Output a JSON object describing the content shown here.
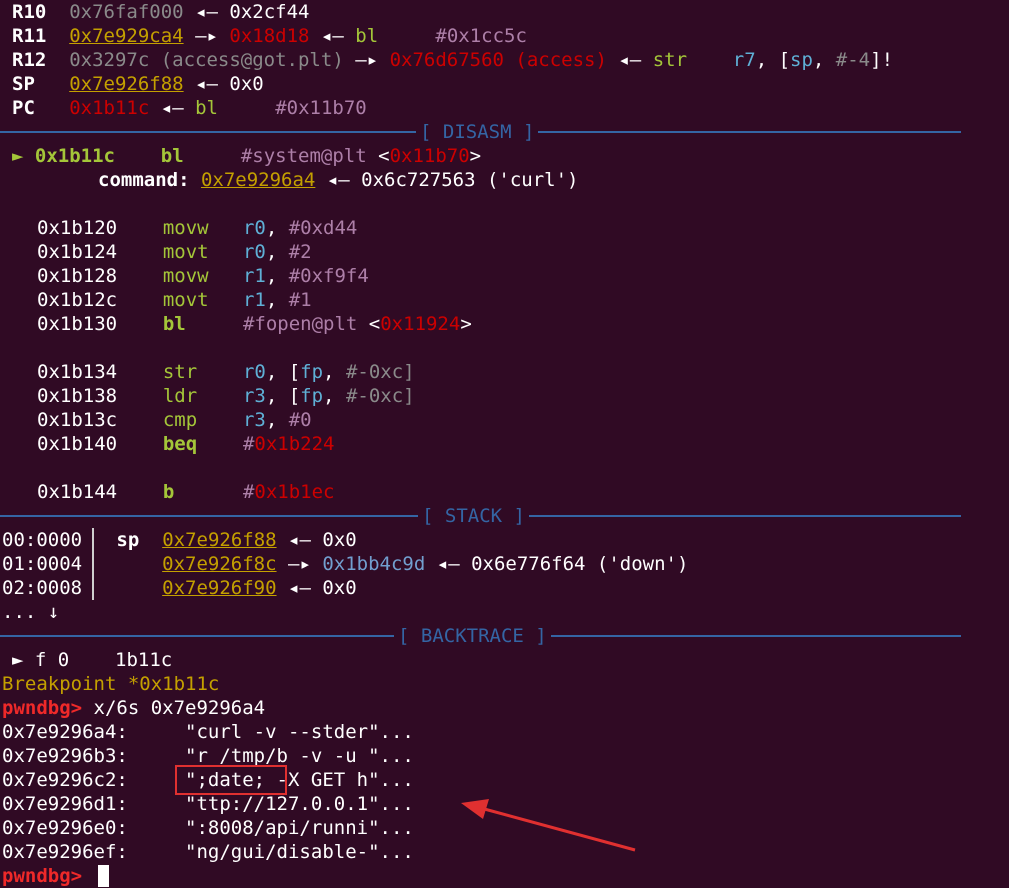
{
  "registers": [
    {
      "name": "R10",
      "addr": "0x76faf000",
      "arrow": "◂—",
      "val": "0x2cf44"
    },
    {
      "name": "R11",
      "addr": "0x7e929ca4",
      "arrow1": "—▸",
      "ptr": "0x18d18",
      "arrow2": "◂—",
      "ins": "bl",
      "arg": "#0x1cc5c"
    },
    {
      "name": "R12",
      "addr": "0x3297c (access@got.plt)",
      "arrow1": "—▸",
      "ptr": "0x76d67560 (access)",
      "arrow2": "◂—",
      "ins": "str",
      "arg_reg": "r7",
      "arg_rest_a": ", [",
      "arg_sp": "sp",
      "arg_rest_b": ", ",
      "arg_off": "#-4",
      "arg_end": "]!"
    },
    {
      "name": "SP",
      "addr": "0x7e926f88",
      "arrow": "◂—",
      "val": "0x0"
    },
    {
      "name": "PC",
      "addr": "0x1b11c",
      "arrow": "◂—",
      "ins": "bl",
      "arg": "#0x11b70"
    }
  ],
  "sections": {
    "disasm": "[ DISASM ]",
    "stack": "[ STACK ]",
    "backtrace": "[ BACKTRACE ]"
  },
  "disasm": {
    "current": {
      "marker": "►",
      "addr": "0x1b11c",
      "ins": "bl",
      "target": "#system@plt",
      "lt": "<",
      "ref": "0x11b70",
      "gt": ">"
    },
    "command": {
      "label": "command:",
      "ptr": "0x7e9296a4",
      "arrow": "◂—",
      "val": "0x6c727563 ('curl')"
    },
    "rows": [
      {
        "addr": "0x1b120",
        "ins": "movw",
        "reg": "r0",
        "rest": ", ",
        "imm": "#0xd44"
      },
      {
        "addr": "0x1b124",
        "ins": "movt",
        "reg": "r0",
        "rest": ", ",
        "imm": "#2"
      },
      {
        "addr": "0x1b128",
        "ins": "movw",
        "reg": "r1",
        "rest": ", ",
        "imm": "#0xf9f4"
      },
      {
        "addr": "0x1b12c",
        "ins": "movt",
        "reg": "r1",
        "rest": ", ",
        "imm": "#1"
      },
      {
        "addr": "0x1b130",
        "ins": "bl",
        "target": "#fopen@plt",
        "lt": "<",
        "ref": "0x11924",
        "gt": ">"
      },
      {
        "addr": "0x1b134",
        "ins": "str",
        "reg": "r0",
        "rest": ", [",
        "base": "fp",
        "comma": ", ",
        "off": "#-0xc",
        "end": "]"
      },
      {
        "addr": "0x1b138",
        "ins": "ldr",
        "reg": "r3",
        "rest": ", [",
        "base": "fp",
        "comma": ", ",
        "off": "#-0xc",
        "end": "]"
      },
      {
        "addr": "0x1b13c",
        "ins": "cmp",
        "reg": "r3",
        "rest": ", ",
        "imm": "#0"
      },
      {
        "addr": "0x1b140",
        "ins": "beq",
        "hash": "#",
        "ref": "0x1b224"
      },
      {
        "addr": "0x1b144",
        "ins": "b",
        "hash": "#",
        "ref": "0x1b1ec"
      }
    ]
  },
  "stack": [
    {
      "idx": "00:0000",
      "tag": "sp",
      "addr": "0x7e926f88",
      "arrow": "◂—",
      "val": "0x0"
    },
    {
      "idx": "01:0004",
      "tag": "",
      "addr": "0x7e926f8c",
      "arrow1": "—▸",
      "ptr": "0x1bb4c9d",
      "arrow2": "◂—",
      "val": "0x6e776f64 ('down')"
    },
    {
      "idx": "02:0008",
      "tag": "",
      "addr": "0x7e926f90",
      "arrow": "◂—",
      "val": "0x0"
    }
  ],
  "stack_more": "... ↓",
  "backtrace": {
    "marker": "►",
    "frame": "f 0",
    "addr": "1b11c"
  },
  "breakpoint": "Breakpoint *0x1b11c",
  "prompt": "pwndbg>",
  "command_input": "x/6s 0x7e9296a4",
  "memory": [
    {
      "addr": "0x7e9296a4:",
      "str": "\"curl -v --stder\"..."
    },
    {
      "addr": "0x7e9296b3:",
      "str": "\"r /tmp/b -v -u \"..."
    },
    {
      "addr": "0x7e9296c2:",
      "str": "\";date; -X GET h\"..."
    },
    {
      "addr": "0x7e9296d1:",
      "str": "\"ttp://127.0.0.1\"..."
    },
    {
      "addr": "0x7e9296e0:",
      "str": "\":8008/api/runni\"..."
    },
    {
      "addr": "0x7e9296ef:",
      "str": "\"ng/gui/disable-\"..."
    }
  ],
  "colors": {
    "background": "#300a24",
    "section": "#3465a4",
    "highlight": "#e03030",
    "prompt": "#ef2929"
  }
}
